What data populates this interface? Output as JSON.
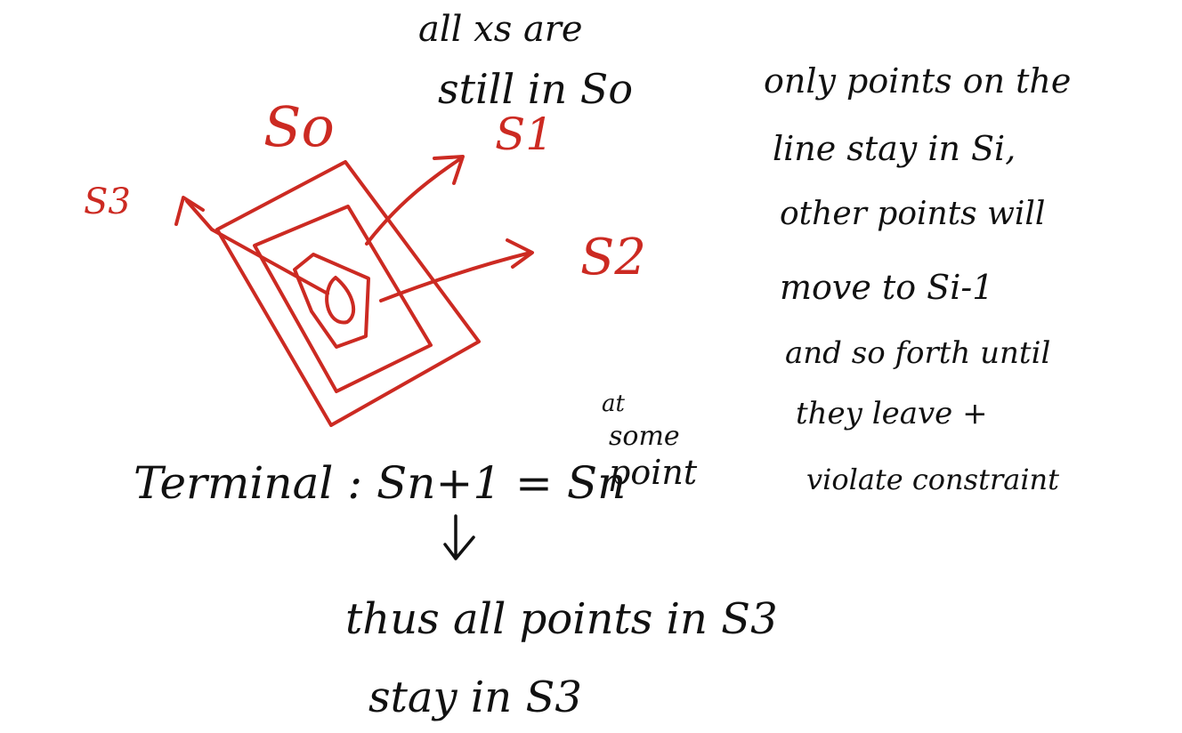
{
  "labels": {
    "s0": "So",
    "s1": "S1",
    "s2": "S2",
    "s3": "S3",
    "top_note_line1": "all xs are",
    "top_note_line2": "still in So",
    "right_note": [
      "only points on the",
      "line stay in Si,",
      "other points will",
      "move to Si-1",
      "and so forth until",
      "they leave +",
      "violate constraint"
    ],
    "terminal": "Terminal : Sn+1 = Sn",
    "at_some_point_line1": "at",
    "at_some_point_line2": "some",
    "at_some_point_line3": "point",
    "conclusion_line1": "thus all points in S3",
    "conclusion_line2": "stay in S3"
  },
  "colors": {
    "ink": "#111111",
    "red": "#cc2a22",
    "background": "#ffffff"
  }
}
